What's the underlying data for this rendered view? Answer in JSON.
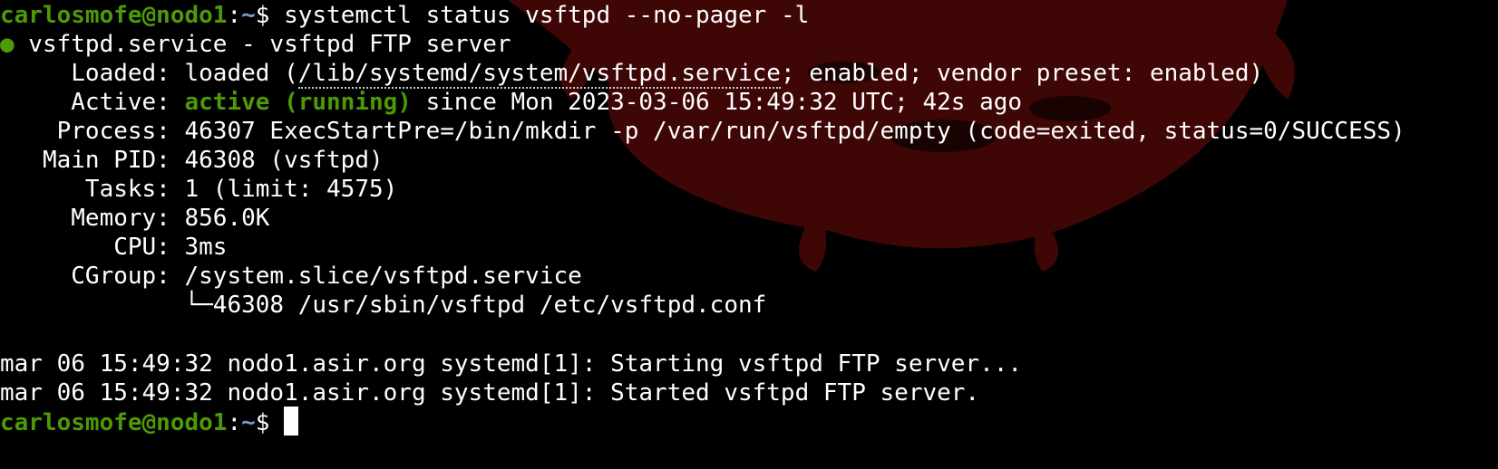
{
  "colors": {
    "background": "#000000",
    "foreground": "#ffffff",
    "prompt_user": "#4e9a06",
    "prompt_path": "#729fcf",
    "status_active": "#4e9a06",
    "background_art": "#5a0a0a"
  },
  "prompt": {
    "user_host": "carlosmofe@nodo1",
    "separator": ":",
    "path": "~",
    "symbol": "$ "
  },
  "command": {
    "text": "systemctl status vsftpd --no-pager -l"
  },
  "status": {
    "dot": "●",
    "unit": " vsftpd.service - vsftpd FTP server",
    "loaded_label": "     Loaded: ",
    "loaded_prefix": "loaded (",
    "loaded_path": "/lib/systemd/system/vsftpd.service",
    "loaded_suffix": "; enabled; vendor preset: enabled)",
    "active_label": "     Active: ",
    "active_state": "active (running)",
    "active_since": " since Mon 2023-03-06 15:49:32 UTC; 42s ago",
    "process": "    Process: 46307 ExecStartPre=/bin/mkdir -p /var/run/vsftpd/empty (code=exited, status=0/SUCCESS)",
    "main_pid": "   Main PID: 46308 (vsftpd)",
    "tasks": "      Tasks: 1 (limit: 4575)",
    "memory": "     Memory: 856.0K",
    "cpu": "        CPU: 3ms",
    "cgroup": "     CGroup: /system.slice/vsftpd.service",
    "cgroup_child": "             └─46308 /usr/sbin/vsftpd /etc/vsftpd.conf"
  },
  "log": [
    "mar 06 15:49:32 nodo1.asir.org systemd[1]: Starting vsftpd FTP server...",
    "mar 06 15:49:32 nodo1.asir.org systemd[1]: Started vsftpd FTP server."
  ]
}
